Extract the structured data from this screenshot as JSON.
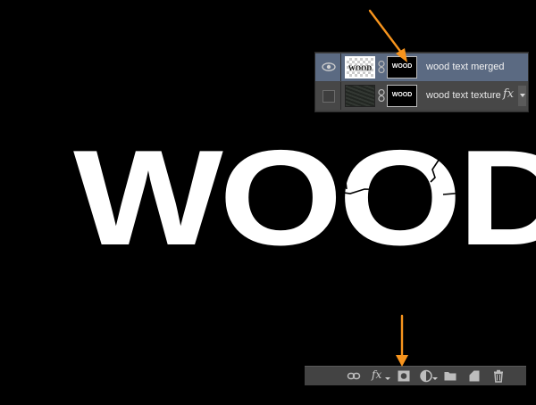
{
  "canvas": {
    "text": "WOOD",
    "background": "#000000",
    "text_color": "#ffffff"
  },
  "layers_panel": {
    "layers": [
      {
        "name": "wood text merged",
        "visible": true,
        "selected": true,
        "thumb_text": "WOOD",
        "mask_text": "WOOD"
      },
      {
        "name": "wood text texture",
        "visible": false,
        "selected": false,
        "fx": "fx",
        "mask_text": "WOOD"
      }
    ]
  },
  "toolbar": {
    "icons": [
      "link-layers-icon",
      "fx-icon",
      "add-mask-icon",
      "adjustment-layer-icon",
      "folder-icon",
      "new-layer-icon",
      "trash-icon"
    ],
    "fx_label": "fx"
  },
  "colors": {
    "selected_row": "#5b6a82",
    "panel_bg": "#434343",
    "arrow": "#f7941d"
  }
}
